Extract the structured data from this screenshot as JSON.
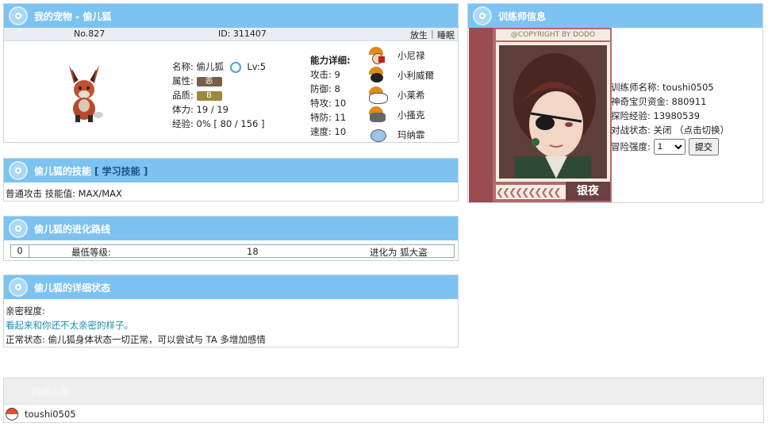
{
  "pet": {
    "header": "我的宠物 - 偷儿狐",
    "number": "No.827",
    "id_text": "ID: 311407",
    "release": "放生",
    "separator": "|",
    "sleep": "睡眠",
    "name_label": "名称:",
    "name": "偷儿狐",
    "level": "Lv:5",
    "attr_label": "属性:",
    "attr": "恶",
    "quality_label": "品质:",
    "quality": "B",
    "hp_label": "体力:",
    "hp": "19 / 19",
    "exp_label": "经验:",
    "exp": "0% [ 80 / 156 ]",
    "stats_title": "能力详细:",
    "stats": [
      {
        "label": "攻击:",
        "value": "9"
      },
      {
        "label": "防御:",
        "value": "8"
      },
      {
        "label": "特攻:",
        "value": "10"
      },
      {
        "label": "特防:",
        "value": "11"
      },
      {
        "label": "速度:",
        "value": "10"
      }
    ],
    "team": [
      "小尼禄",
      "小利威爾",
      "小莱希",
      "小搔克",
      "玛纳霏"
    ]
  },
  "skills": {
    "header": "偷儿狐的技能",
    "link": "[ 学习技能 ]",
    "line": "普通攻击 技能值: MAX/MAX"
  },
  "evolution": {
    "header": "偷儿狐的进化路线",
    "index": "0",
    "min_label": "最低等级:",
    "min_value": "18",
    "evolve_to": "进化为 狐大盗"
  },
  "status": {
    "header": "偷儿狐的详细状态",
    "intimacy_label": "亲密程度:",
    "intimacy_text": "看起来和你还不太亲密的样子。",
    "normal_text": "正常状态: 偷儿狐身体状态一切正常，可以尝试与 TA 多增加感情"
  },
  "trainer": {
    "header": "训练师信息",
    "copyright": "@COPYRIGHT BY DODO",
    "card_name": "银夜",
    "name_line": "训练师名称: toushi0505",
    "money_line": "神奇宝贝资金: 880911",
    "exp_line": "探险经验: 13980539",
    "battle_line": "对战状态: 关闭 （点击切换）",
    "adventure_label": "冒险强度:",
    "adventure_value": "1",
    "submit": "提交"
  },
  "online": {
    "header": "同线会员",
    "user": "toushi0505"
  },
  "colors": {
    "header_bg": "#7cc3f2",
    "attr_badge": "#7a5e4a",
    "quality_badge": "#9a8a3c",
    "intimacy_text": "#1a8fb0"
  }
}
